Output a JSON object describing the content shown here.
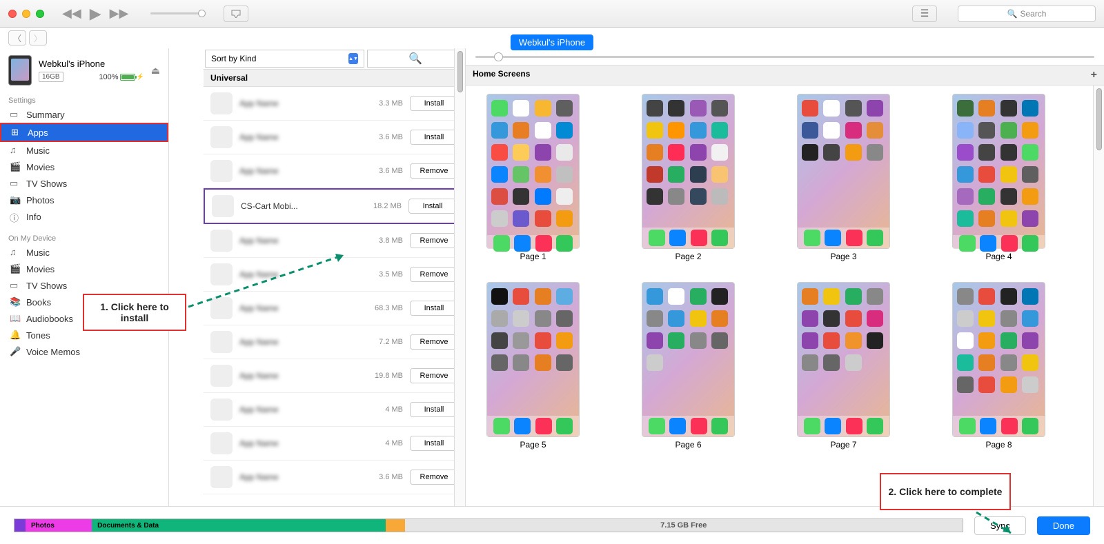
{
  "topbar": {
    "search_placeholder": "Search"
  },
  "device_pill": "Webkul's iPhone",
  "device": {
    "name": "Webkul's iPhone",
    "capacity": "16GB",
    "battery": "100%"
  },
  "sidebar": {
    "settings_label": "Settings",
    "settings_items": [
      {
        "label": "Summary"
      },
      {
        "label": "Apps"
      },
      {
        "label": "Music"
      },
      {
        "label": "Movies"
      },
      {
        "label": "TV Shows"
      },
      {
        "label": "Photos"
      },
      {
        "label": "Info"
      }
    ],
    "device_label": "On My Device",
    "device_items": [
      {
        "label": "Music"
      },
      {
        "label": "Movies"
      },
      {
        "label": "TV Shows"
      },
      {
        "label": "Books"
      },
      {
        "label": "Audiobooks"
      },
      {
        "label": "Tones"
      },
      {
        "label": "Voice Memos"
      }
    ]
  },
  "apps_panel": {
    "sort_label": "Sort by Kind",
    "section": "Universal",
    "rows": [
      {
        "name": "",
        "size": "3.3 MB",
        "action": "Install",
        "highlight": false,
        "clear": false
      },
      {
        "name": "",
        "size": "3.6 MB",
        "action": "Install",
        "highlight": false,
        "clear": false
      },
      {
        "name": "",
        "size": "3.6 MB",
        "action": "Remove",
        "highlight": false,
        "clear": false
      },
      {
        "name": "CS-Cart Mobi...",
        "size": "18.2 MB",
        "action": "Install",
        "highlight": true,
        "clear": true
      },
      {
        "name": "",
        "size": "3.8 MB",
        "action": "Remove",
        "highlight": false,
        "clear": false
      },
      {
        "name": "",
        "size": "3.5 MB",
        "action": "Remove",
        "highlight": false,
        "clear": false
      },
      {
        "name": "",
        "size": "68.3 MB",
        "action": "Install",
        "highlight": false,
        "clear": false
      },
      {
        "name": "",
        "size": "7.2 MB",
        "action": "Remove",
        "highlight": false,
        "clear": false
      },
      {
        "name": "",
        "size": "19.8 MB",
        "action": "Remove",
        "highlight": false,
        "clear": false
      },
      {
        "name": "",
        "size": "4 MB",
        "action": "Install",
        "highlight": false,
        "clear": false
      },
      {
        "name": "",
        "size": "4 MB",
        "action": "Install",
        "highlight": false,
        "clear": false
      },
      {
        "name": "",
        "size": "3.6 MB",
        "action": "Remove",
        "highlight": false,
        "clear": false
      }
    ]
  },
  "home_screens": {
    "header": "Home Screens",
    "pages": [
      "Page 1",
      "Page 2",
      "Page 3",
      "Page 4",
      "Page 5",
      "Page 6",
      "Page 7",
      "Page 8"
    ]
  },
  "storage": {
    "photos": "Photos",
    "docs": "Documents & Data",
    "free": "7.15 GB Free",
    "sync": "Sync",
    "done": "Done"
  },
  "annotations": {
    "step1": "1. Click here to install",
    "step2": "2. Click here to complete"
  },
  "app_colors": [
    [
      "#4cd964",
      "#fff",
      "#f7b731",
      "#5f5f5f",
      "#3498db",
      "#e77e23",
      "#fff",
      "#028bd4",
      "#f94c43",
      "#fdcb58",
      "#8e44ad",
      "#e9e9e9",
      "#0a84ff",
      "#65c466",
      "#f09030",
      "#c0c0c0",
      "#dc4e41",
      "#333",
      "#007aff",
      "#eee",
      "#ccc",
      "#6a5acd",
      "#e74c3c",
      "#f39c12"
    ],
    [
      "#444",
      "#333",
      "#9b59b6",
      "#555",
      "#f1c40f",
      "#ff9500",
      "#3498db",
      "#1abc9c",
      "#e67e22",
      "#ff2d55",
      "#8e44ad",
      "#f1f1f1",
      "#c0392b",
      "#27ae60",
      "#2c3e50",
      "#f8c471",
      "#333",
      "#888",
      "#34495e",
      "#bbb"
    ],
    [
      "#e74c3c",
      "#fff",
      "#555",
      "#8e44ad",
      "#3b5998",
      "#fff",
      "#d82d7e",
      "#e58e3a",
      "#222",
      "#444",
      "#f39c12",
      "#888"
    ],
    [
      "#3c6e3c",
      "#e67e22",
      "#333",
      "#0077b5",
      "#8ab4f8",
      "#555",
      "#4caf50",
      "#f39c12",
      "#9a4cca",
      "#444",
      "#333",
      "#4cd964",
      "#3498db",
      "#e74c3c",
      "#f1c40f",
      "#5f5f5f",
      "#a569bd",
      "#27ae60",
      "#333",
      "#f39c12",
      "#1abc9c",
      "#e67e22",
      "#f1c40f",
      "#8e44ad"
    ],
    [
      "#111",
      "#e74c3c",
      "#e67e22",
      "#5dade2",
      "#aaa",
      "#ccc",
      "#888",
      "#666",
      "#444",
      "#999",
      "#e74c3c",
      "#f39c12",
      "#666",
      "#888",
      "#e67e22",
      "#666"
    ],
    [
      "#3498db",
      "#fff",
      "#27ae60",
      "#222",
      "#888",
      "#3498db",
      "#f1c40f",
      "#e67e22",
      "#8e44ad",
      "#27ae60",
      "#888",
      "#666",
      "#ccc"
    ],
    [
      "#e67e22",
      "#f1c40f",
      "#27ae60",
      "#888",
      "#8e44ad",
      "#333",
      "#e74c3c",
      "#d82d7e",
      "#8e44ad",
      "#e74c3c",
      "#f0932b",
      "#222",
      "#888",
      "#666",
      "#ccc"
    ],
    [
      "#888",
      "#e74c3c",
      "#222",
      "#0077b5",
      "#ccc",
      "#f1c40f",
      "#888",
      "#3498db",
      "#fff",
      "#f39c12",
      "#27ae60",
      "#8e44ad",
      "#1abc9c",
      "#e67e22",
      "#888",
      "#f1c40f",
      "#666",
      "#e74c3c",
      "#f39c12",
      "#ccc"
    ]
  ]
}
